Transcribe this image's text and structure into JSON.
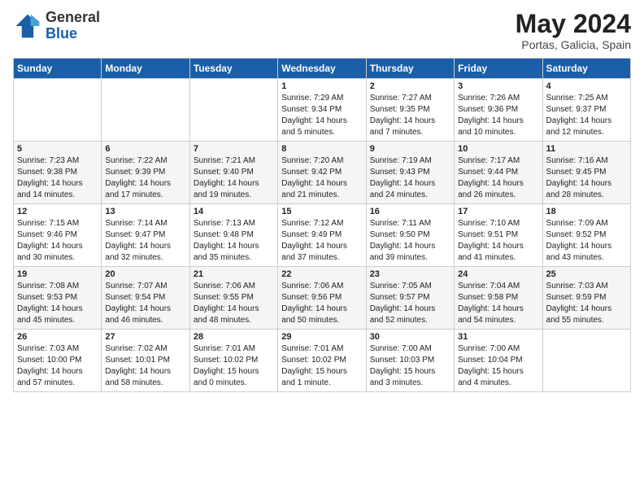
{
  "logo": {
    "general": "General",
    "blue": "Blue"
  },
  "title": {
    "month_year": "May 2024",
    "location": "Portas, Galicia, Spain"
  },
  "weekdays": [
    "Sunday",
    "Monday",
    "Tuesday",
    "Wednesday",
    "Thursday",
    "Friday",
    "Saturday"
  ],
  "weeks": [
    [
      {
        "day": "",
        "sunrise": "",
        "sunset": "",
        "daylight": ""
      },
      {
        "day": "",
        "sunrise": "",
        "sunset": "",
        "daylight": ""
      },
      {
        "day": "",
        "sunrise": "",
        "sunset": "",
        "daylight": ""
      },
      {
        "day": "1",
        "sunrise": "Sunrise: 7:29 AM",
        "sunset": "Sunset: 9:34 PM",
        "daylight": "Daylight: 14 hours and 5 minutes."
      },
      {
        "day": "2",
        "sunrise": "Sunrise: 7:27 AM",
        "sunset": "Sunset: 9:35 PM",
        "daylight": "Daylight: 14 hours and 7 minutes."
      },
      {
        "day": "3",
        "sunrise": "Sunrise: 7:26 AM",
        "sunset": "Sunset: 9:36 PM",
        "daylight": "Daylight: 14 hours and 10 minutes."
      },
      {
        "day": "4",
        "sunrise": "Sunrise: 7:25 AM",
        "sunset": "Sunset: 9:37 PM",
        "daylight": "Daylight: 14 hours and 12 minutes."
      }
    ],
    [
      {
        "day": "5",
        "sunrise": "Sunrise: 7:23 AM",
        "sunset": "Sunset: 9:38 PM",
        "daylight": "Daylight: 14 hours and 14 minutes."
      },
      {
        "day": "6",
        "sunrise": "Sunrise: 7:22 AM",
        "sunset": "Sunset: 9:39 PM",
        "daylight": "Daylight: 14 hours and 17 minutes."
      },
      {
        "day": "7",
        "sunrise": "Sunrise: 7:21 AM",
        "sunset": "Sunset: 9:40 PM",
        "daylight": "Daylight: 14 hours and 19 minutes."
      },
      {
        "day": "8",
        "sunrise": "Sunrise: 7:20 AM",
        "sunset": "Sunset: 9:42 PM",
        "daylight": "Daylight: 14 hours and 21 minutes."
      },
      {
        "day": "9",
        "sunrise": "Sunrise: 7:19 AM",
        "sunset": "Sunset: 9:43 PM",
        "daylight": "Daylight: 14 hours and 24 minutes."
      },
      {
        "day": "10",
        "sunrise": "Sunrise: 7:17 AM",
        "sunset": "Sunset: 9:44 PM",
        "daylight": "Daylight: 14 hours and 26 minutes."
      },
      {
        "day": "11",
        "sunrise": "Sunrise: 7:16 AM",
        "sunset": "Sunset: 9:45 PM",
        "daylight": "Daylight: 14 hours and 28 minutes."
      }
    ],
    [
      {
        "day": "12",
        "sunrise": "Sunrise: 7:15 AM",
        "sunset": "Sunset: 9:46 PM",
        "daylight": "Daylight: 14 hours and 30 minutes."
      },
      {
        "day": "13",
        "sunrise": "Sunrise: 7:14 AM",
        "sunset": "Sunset: 9:47 PM",
        "daylight": "Daylight: 14 hours and 32 minutes."
      },
      {
        "day": "14",
        "sunrise": "Sunrise: 7:13 AM",
        "sunset": "Sunset: 9:48 PM",
        "daylight": "Daylight: 14 hours and 35 minutes."
      },
      {
        "day": "15",
        "sunrise": "Sunrise: 7:12 AM",
        "sunset": "Sunset: 9:49 PM",
        "daylight": "Daylight: 14 hours and 37 minutes."
      },
      {
        "day": "16",
        "sunrise": "Sunrise: 7:11 AM",
        "sunset": "Sunset: 9:50 PM",
        "daylight": "Daylight: 14 hours and 39 minutes."
      },
      {
        "day": "17",
        "sunrise": "Sunrise: 7:10 AM",
        "sunset": "Sunset: 9:51 PM",
        "daylight": "Daylight: 14 hours and 41 minutes."
      },
      {
        "day": "18",
        "sunrise": "Sunrise: 7:09 AM",
        "sunset": "Sunset: 9:52 PM",
        "daylight": "Daylight: 14 hours and 43 minutes."
      }
    ],
    [
      {
        "day": "19",
        "sunrise": "Sunrise: 7:08 AM",
        "sunset": "Sunset: 9:53 PM",
        "daylight": "Daylight: 14 hours and 45 minutes."
      },
      {
        "day": "20",
        "sunrise": "Sunrise: 7:07 AM",
        "sunset": "Sunset: 9:54 PM",
        "daylight": "Daylight: 14 hours and 46 minutes."
      },
      {
        "day": "21",
        "sunrise": "Sunrise: 7:06 AM",
        "sunset": "Sunset: 9:55 PM",
        "daylight": "Daylight: 14 hours and 48 minutes."
      },
      {
        "day": "22",
        "sunrise": "Sunrise: 7:06 AM",
        "sunset": "Sunset: 9:56 PM",
        "daylight": "Daylight: 14 hours and 50 minutes."
      },
      {
        "day": "23",
        "sunrise": "Sunrise: 7:05 AM",
        "sunset": "Sunset: 9:57 PM",
        "daylight": "Daylight: 14 hours and 52 minutes."
      },
      {
        "day": "24",
        "sunrise": "Sunrise: 7:04 AM",
        "sunset": "Sunset: 9:58 PM",
        "daylight": "Daylight: 14 hours and 54 minutes."
      },
      {
        "day": "25",
        "sunrise": "Sunrise: 7:03 AM",
        "sunset": "Sunset: 9:59 PM",
        "daylight": "Daylight: 14 hours and 55 minutes."
      }
    ],
    [
      {
        "day": "26",
        "sunrise": "Sunrise: 7:03 AM",
        "sunset": "Sunset: 10:00 PM",
        "daylight": "Daylight: 14 hours and 57 minutes."
      },
      {
        "day": "27",
        "sunrise": "Sunrise: 7:02 AM",
        "sunset": "Sunset: 10:01 PM",
        "daylight": "Daylight: 14 hours and 58 minutes."
      },
      {
        "day": "28",
        "sunrise": "Sunrise: 7:01 AM",
        "sunset": "Sunset: 10:02 PM",
        "daylight": "Daylight: 15 hours and 0 minutes."
      },
      {
        "day": "29",
        "sunrise": "Sunrise: 7:01 AM",
        "sunset": "Sunset: 10:02 PM",
        "daylight": "Daylight: 15 hours and 1 minute."
      },
      {
        "day": "30",
        "sunrise": "Sunrise: 7:00 AM",
        "sunset": "Sunset: 10:03 PM",
        "daylight": "Daylight: 15 hours and 3 minutes."
      },
      {
        "day": "31",
        "sunrise": "Sunrise: 7:00 AM",
        "sunset": "Sunset: 10:04 PM",
        "daylight": "Daylight: 15 hours and 4 minutes."
      },
      {
        "day": "",
        "sunrise": "",
        "sunset": "",
        "daylight": ""
      }
    ]
  ]
}
